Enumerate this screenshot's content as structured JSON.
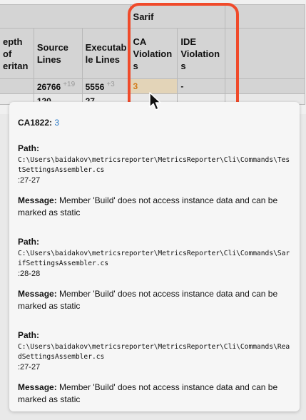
{
  "table": {
    "group_headers": {
      "left": "",
      "sarif": "Sarif"
    },
    "columns": [
      {
        "label": "epth of\neritan"
      },
      {
        "label": "Source\nLines"
      },
      {
        "label": "Executab\nle Lines"
      },
      {
        "label": "CA\nViolation\ns"
      },
      {
        "label": "IDE\nViolation\ns"
      }
    ],
    "rows": [
      {
        "depth": "",
        "source_lines": "26766",
        "source_delta": "+19",
        "exec_lines": "5556",
        "exec_delta": "+3",
        "ca_violations": "3",
        "ide_violations": "-"
      },
      {
        "depth": "",
        "source_lines": "120",
        "exec_lines": "27"
      }
    ]
  },
  "tooltip": {
    "rule_id": "CA1822:",
    "rule_count": "3",
    "path_label": "Path:",
    "message_label": "Message:",
    "entries": [
      {
        "path": "C:\\Users\\baidakov\\metricsreporter\\MetricsReporter\\Cli\\Commands\\TestSettingsAssembler.cs",
        "lines": ":27-27",
        "message": "Member 'Build' does not access instance data and can be marked as static"
      },
      {
        "path": "C:\\Users\\baidakov\\metricsreporter\\MetricsReporter\\Cli\\Commands\\SarifSettingsAssembler.cs",
        "lines": ":28-28",
        "message": "Member 'Build' does not access instance data and can be marked as static"
      },
      {
        "path": "C:\\Users\\baidakov\\metricsreporter\\MetricsReporter\\Cli\\Commands\\ReadSettingsAssembler.cs",
        "lines": ":27-27",
        "message": "Member 'Build' does not access instance data and can be marked as static"
      }
    ]
  },
  "colors": {
    "highlight": "#f04a2a",
    "ca_value": "#d17a1a",
    "rule_count": "#2a7ac8"
  },
  "icons": {
    "cursor": "mouse-pointer-icon"
  }
}
